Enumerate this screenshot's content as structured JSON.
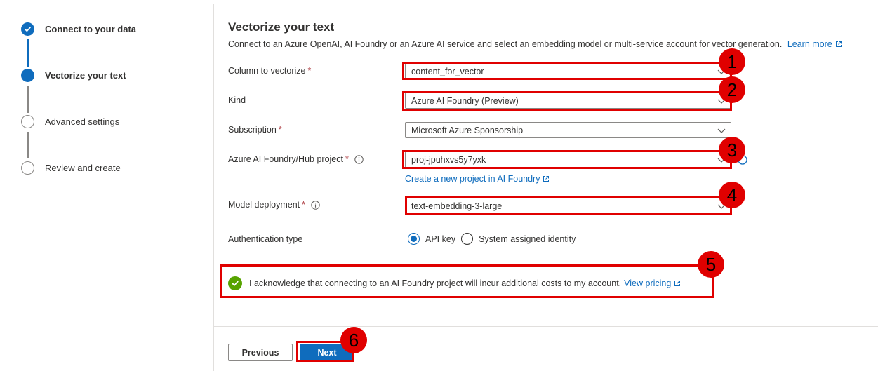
{
  "steps": [
    {
      "label": "Connect to your data",
      "state": "done"
    },
    {
      "label": "Vectorize your text",
      "state": "current"
    },
    {
      "label": "Advanced settings",
      "state": "todo"
    },
    {
      "label": "Review and create",
      "state": "todo"
    }
  ],
  "main": {
    "title": "Vectorize your text",
    "description": "Connect to an Azure OpenAI, AI Foundry or an Azure AI service and select an embedding model or multi-service account for vector generation.",
    "learn_more": "Learn more"
  },
  "fields": {
    "column": {
      "label": "Column to vectorize",
      "required_mark": "*",
      "value": "content_for_vector"
    },
    "kind": {
      "label": "Kind",
      "value": "Azure AI Foundry (Preview)"
    },
    "subscription": {
      "label": "Subscription",
      "required_mark": "*",
      "value": "Microsoft Azure Sponsorship"
    },
    "project": {
      "label": "Azure AI Foundry/Hub project",
      "required_mark": "*",
      "value": "proj-jpuhxvs5y7yxk",
      "create_link": "Create a new project in AI Foundry"
    },
    "model": {
      "label": "Model deployment",
      "required_mark": "*",
      "value": "text-embedding-3-large"
    },
    "auth": {
      "label": "Authentication type",
      "options": [
        "API key",
        "System assigned identity"
      ],
      "selected": "API key"
    }
  },
  "ack": {
    "text": "I acknowledge that connecting to an AI Foundry project will incur additional costs to my account.",
    "link": "View pricing"
  },
  "footer": {
    "previous": "Previous",
    "next": "Next"
  },
  "annotations": [
    "1",
    "2",
    "3",
    "4",
    "5",
    "6"
  ],
  "colors": {
    "accent": "#0f6cbd",
    "highlight": "#e00000",
    "success": "#57a300",
    "required": "#a4262c"
  }
}
